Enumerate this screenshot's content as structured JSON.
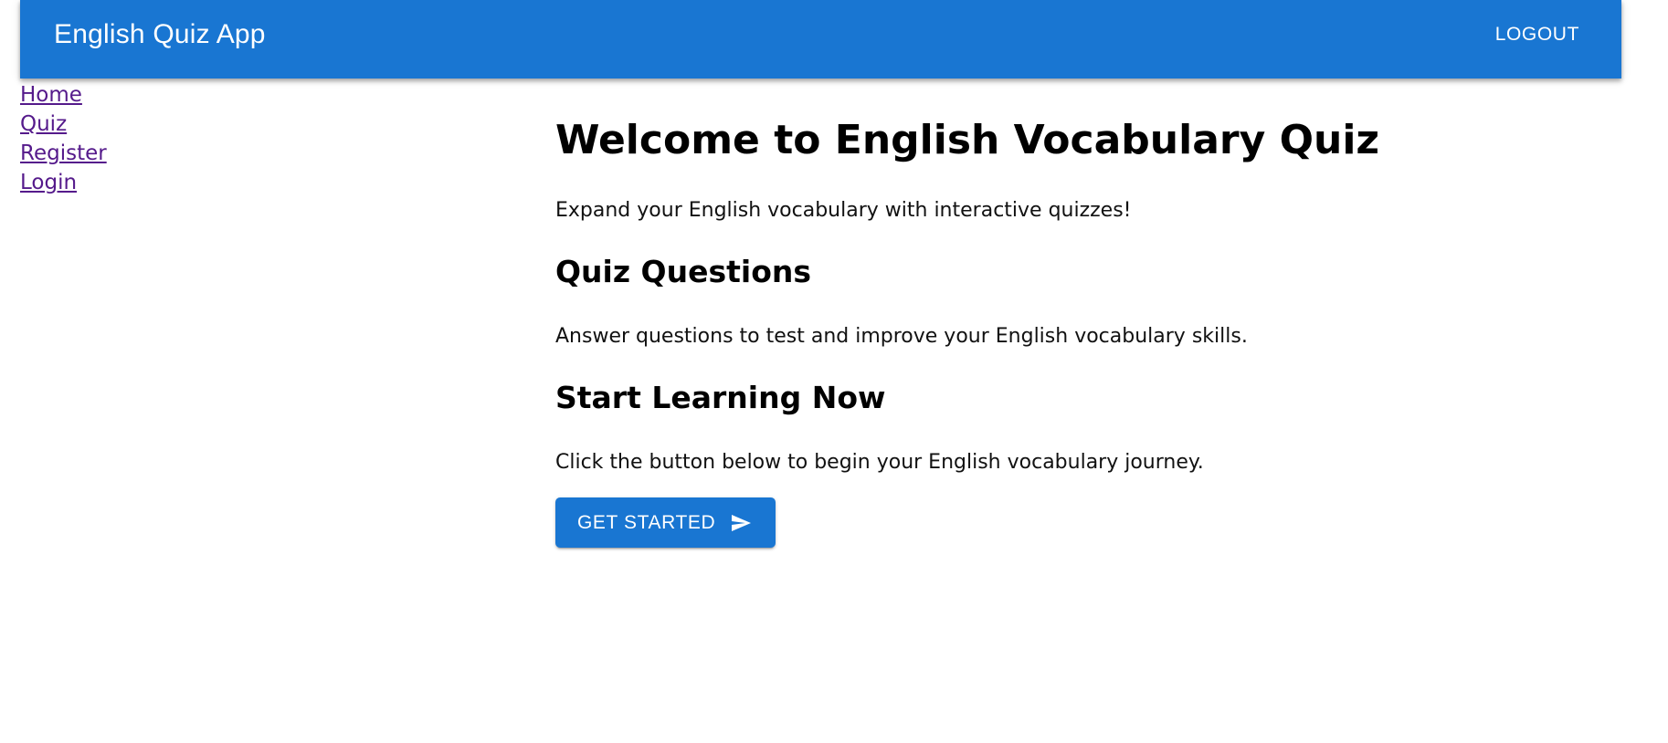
{
  "header": {
    "title": "English Quiz App",
    "logout_label": "LOGOUT"
  },
  "nav": {
    "items": [
      {
        "label": "Home"
      },
      {
        "label": "Quiz"
      },
      {
        "label": "Register"
      },
      {
        "label": "Login"
      }
    ]
  },
  "main": {
    "heading": "Welcome to English Vocabulary Quiz",
    "intro": "Expand your English vocabulary with interactive quizzes!",
    "quiz_heading": "Quiz Questions",
    "quiz_text": "Answer questions to test and improve your English vocabulary skills.",
    "start_heading": "Start Learning Now",
    "start_text": "Click the button below to begin your English vocabulary journey.",
    "cta_label": "GET STARTED",
    "cta_icon": "send-icon"
  },
  "colors": {
    "primary": "#1976d2",
    "link_visited": "#551a8b"
  }
}
